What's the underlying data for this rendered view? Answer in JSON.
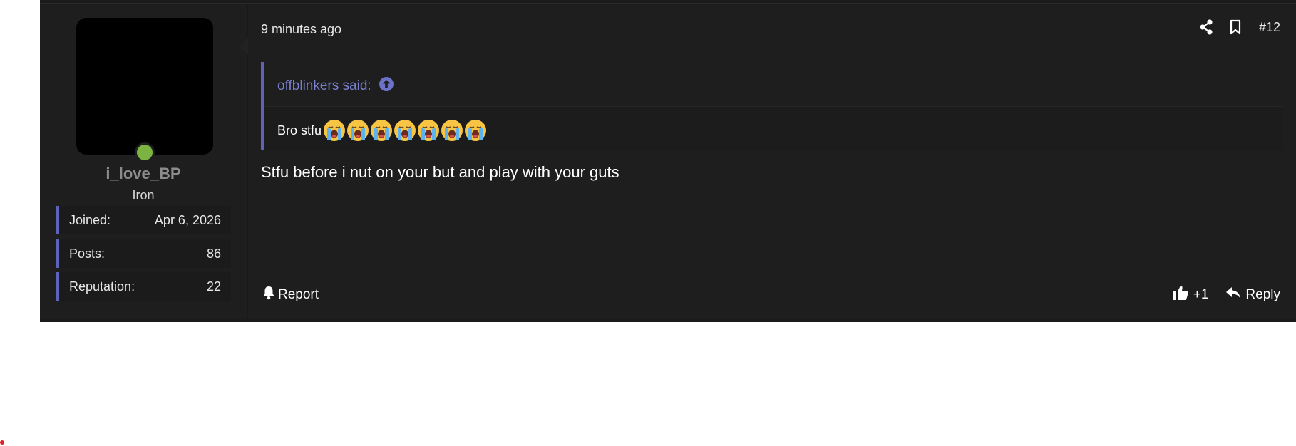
{
  "post": {
    "user": {
      "username": "i_love_BP",
      "title": "Iron",
      "online_status_color": "#7cb342",
      "stats": [
        {
          "label": "Joined:",
          "value": "Apr 6, 2026"
        },
        {
          "label": "Posts:",
          "value": "86"
        },
        {
          "label": "Reputation:",
          "value": "22"
        }
      ]
    },
    "time": "9 minutes ago",
    "post_number": "#12",
    "quote": {
      "author_label": "offblinkers said:",
      "text": "Bro stfu",
      "emoji_count": 7,
      "emoji_name": "loudly-crying-face"
    },
    "message": "Stfu before i nut on your but and play with your guts",
    "footer": {
      "report_label": "Report",
      "reaction_count": "+1",
      "reply_label": "Reply"
    },
    "accent_color": "#5c63b8"
  }
}
